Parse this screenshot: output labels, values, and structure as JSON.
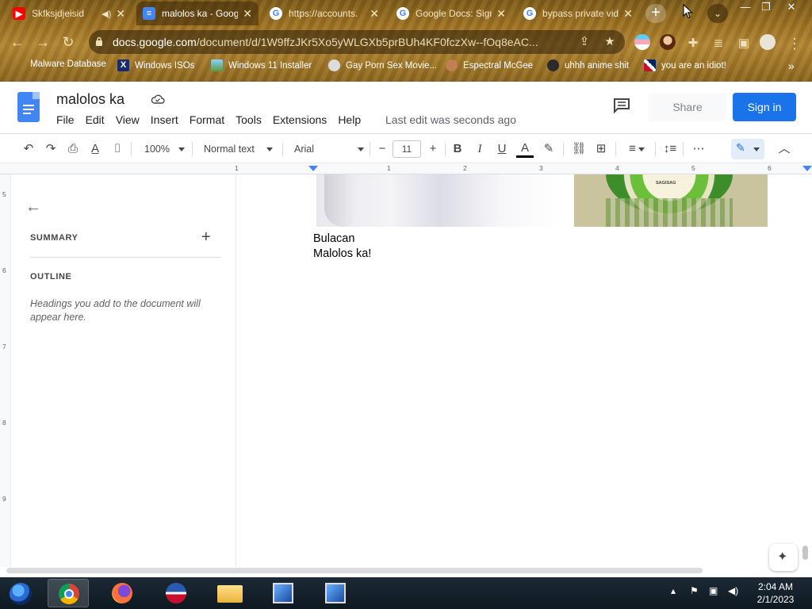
{
  "browser": {
    "tabs": [
      {
        "title": "Skfksjdjeisid",
        "icon": "youtube-icon",
        "audio": true
      },
      {
        "title": "malolos ka - Google",
        "icon": "docs-icon",
        "active": true
      },
      {
        "title": "https://accounts.",
        "icon": "google-icon"
      },
      {
        "title": "Google Docs: Sign",
        "icon": "google-icon"
      },
      {
        "title": "bypass private vid",
        "icon": "google-icon"
      }
    ],
    "url_host": "docs.google.com",
    "url_path": "/document/d/1W9ffzJKr5Xo5yWLGXb5prBUh4KF0fczXw--fOq8eAC...",
    "bookmarks": [
      {
        "label": "Malware Database"
      },
      {
        "label": "Windows ISOs"
      },
      {
        "label": "Windows 11 Installer"
      },
      {
        "label": "Gay Porn Sex Movie..."
      },
      {
        "label": "Espectral McGee"
      },
      {
        "label": "uhhh anime shit"
      },
      {
        "label": "you are an idiot!"
      }
    ],
    "more_bookmarks": "»"
  },
  "docs": {
    "title": "malolos ka",
    "menus": [
      "File",
      "Edit",
      "View",
      "Insert",
      "Format",
      "Tools",
      "Extensions",
      "Help"
    ],
    "last_edit": "Last edit was seconds ago",
    "share_label": "Share",
    "signin_label": "Sign in",
    "toolbar": {
      "zoom": "100%",
      "style": "Normal text",
      "font": "Arial",
      "font_size": "11",
      "minus": "−",
      "plus": "+",
      "bold": "B",
      "italic": "I",
      "underline": "U",
      "text_color": "A",
      "more": "⋯"
    },
    "ruler_numbers": [
      "1",
      "1",
      "2",
      "3",
      "4",
      "5",
      "6"
    ],
    "vruler_numbers": [
      "5",
      "6",
      "7",
      "8",
      "9"
    ],
    "sidebar": {
      "summary_label": "SUMMARY",
      "outline_label": "OUTLINE",
      "outline_hint": "Headings you add to the document will appear here."
    },
    "seal_text": "SAGISAG",
    "body_lines": [
      "Bulacan",
      "Malolos ka!"
    ]
  },
  "taskbar": {
    "time": "2:04 AM",
    "date": "2/1/2023"
  },
  "colors": {
    "docs_blue": "#4285f4",
    "signin_blue": "#1a73e8",
    "chrome_gold": "#9a6f22"
  }
}
